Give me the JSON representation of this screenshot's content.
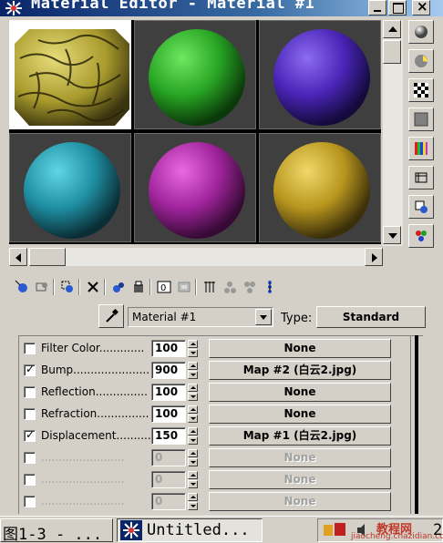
{
  "window": {
    "title": "Material Editor - Material #1",
    "controls": [
      "minimize",
      "maximize",
      "close"
    ]
  },
  "sample_slots": [
    {
      "name": "slot-1",
      "material": "bump-texture",
      "color": "#bdb34a",
      "active": true
    },
    {
      "name": "slot-2",
      "material": "green",
      "color": "#2fb52a",
      "active": false
    },
    {
      "name": "slot-3",
      "material": "purple",
      "color": "#5a30c8",
      "active": false
    },
    {
      "name": "slot-4",
      "material": "teal",
      "color": "#2aa3b5",
      "active": false
    },
    {
      "name": "slot-5",
      "material": "magenta",
      "color": "#b52ab0",
      "active": false
    },
    {
      "name": "slot-6",
      "material": "gold",
      "color": "#c8aa2a",
      "active": false
    }
  ],
  "right_toolbar": [
    "sample-type-sphere-icon",
    "backlight-icon",
    "background-checker-icon",
    "sample-uv-tiling-icon",
    "video-color-check-icon",
    "make-preview-icon",
    "options-icon",
    "select-by-material-icon"
  ],
  "bottom_toolbar": [
    "get-material-icon",
    "put-to-scene-icon",
    "assign-to-selection-icon",
    "reset-map-icon",
    "make-unique-icon",
    "put-to-library-icon",
    "material-effects-channel-icon",
    "show-map-in-viewport-icon",
    "show-end-result-icon",
    "go-to-parent-icon",
    "go-forward-to-sibling-icon",
    "material-navigator-icon"
  ],
  "material_name": "Material #1",
  "type": {
    "label": "Type:",
    "value": "Standard"
  },
  "maps": [
    {
      "label": "Filter Color.............",
      "checked": false,
      "amount": "100",
      "map": "None",
      "enabled": true
    },
    {
      "label": "Bump......................",
      "checked": true,
      "amount": "900",
      "map": "Map #2 (白云2.jpg)",
      "enabled": true
    },
    {
      "label": "Reflection...............",
      "checked": false,
      "amount": "100",
      "map": "None",
      "enabled": true
    },
    {
      "label": "Refraction...............",
      "checked": false,
      "amount": "100",
      "map": "None",
      "enabled": true
    },
    {
      "label": "Displacement...........",
      "checked": true,
      "amount": "150",
      "map": "Map #1 (白云2.jpg)",
      "enabled": true
    },
    {
      "label": "........................",
      "checked": false,
      "amount": "0",
      "map": "None",
      "enabled": false
    },
    {
      "label": "........................",
      "checked": false,
      "amount": "0",
      "map": "None",
      "enabled": false
    },
    {
      "label": "........................",
      "checked": false,
      "amount": "0",
      "map": "None",
      "enabled": false
    }
  ],
  "taskbar": {
    "item1": "图1-3 - ...",
    "item2": "Untitled...",
    "clock": "2",
    "watermark": "教程网",
    "watermark_url": "jiaocheng.chazidian.com"
  }
}
